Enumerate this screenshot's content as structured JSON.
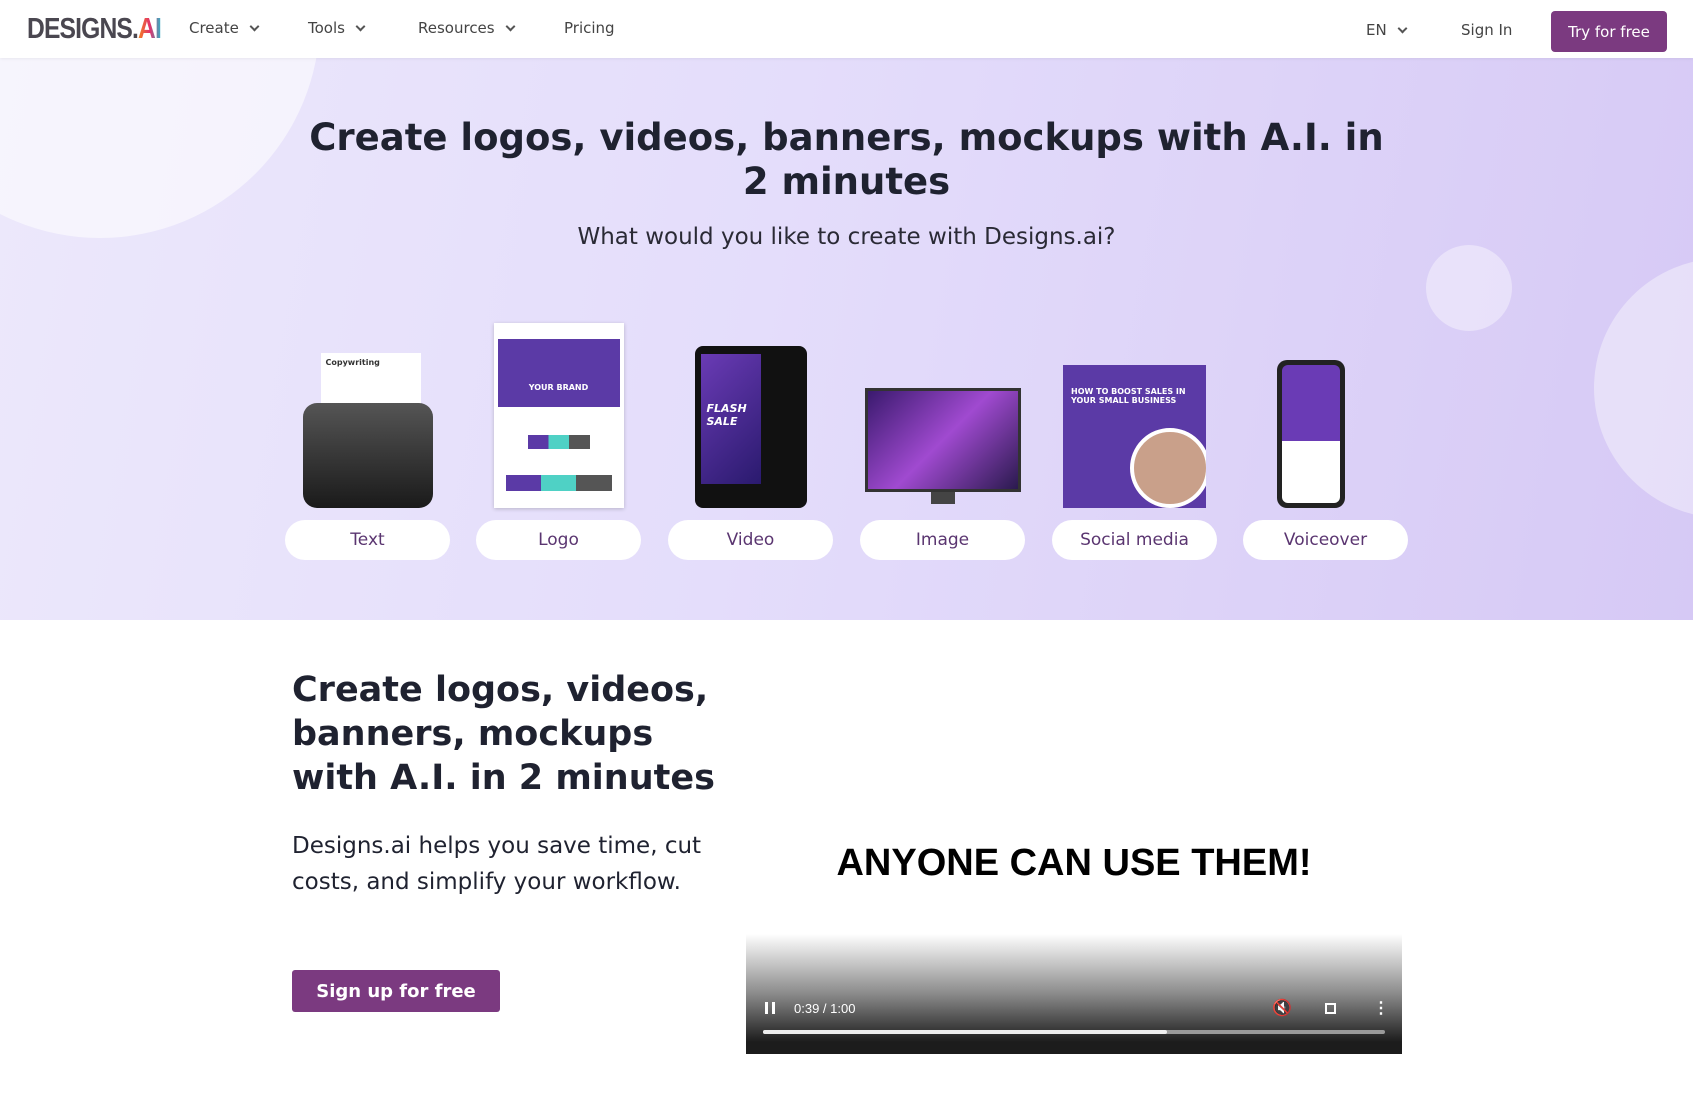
{
  "nav": {
    "logo": "DESIGNS.",
    "logo_ai": "AI",
    "items": [
      {
        "label": "Create",
        "dropdown": true
      },
      {
        "label": "Tools",
        "dropdown": true
      },
      {
        "label": "Resources",
        "dropdown": true
      },
      {
        "label": "Pricing",
        "dropdown": false
      }
    ],
    "language": "EN",
    "sign_in": "Sign In",
    "try_free": "Try for free"
  },
  "hero": {
    "title": "Create logos, videos, banners, mockups with A.I. in 2 minutes",
    "subtitle": "What would you like to create with Designs.ai?",
    "cards": [
      {
        "label": "Text",
        "thumb_text": "Copywriting"
      },
      {
        "label": "Logo",
        "thumb_text": "YOUR BRAND"
      },
      {
        "label": "Video",
        "thumb_text": "FLASH SALE"
      },
      {
        "label": "Image"
      },
      {
        "label": "Social media",
        "thumb_text": "HOW TO BOOST SALES IN YOUR SMALL BUSINESS"
      },
      {
        "label": "Voiceover"
      }
    ]
  },
  "section": {
    "title": "Create logos, videos, banners, mockups with A.I. in 2 minutes",
    "body": "Designs.ai helps you save time, cut costs, and simplify your workflow.",
    "cta": "Sign up for free"
  },
  "video": {
    "caption": "ANYONE CAN USE THEM!",
    "time": "0:39 / 1:00",
    "progress": 0.65,
    "muted": true
  },
  "colors": {
    "brand": "#7b3a80",
    "hero_bg": "#e4ddfb"
  }
}
